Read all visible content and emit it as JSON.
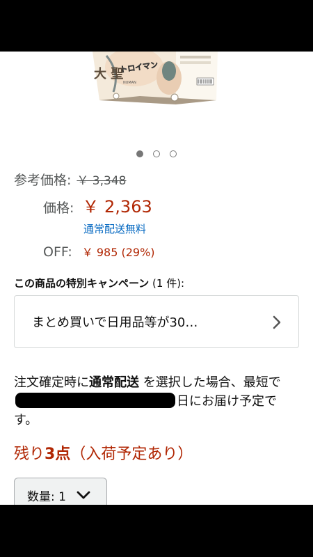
{
  "product": {
    "box_text_main": "トロイマン",
    "box_text_sub": "NUMAN",
    "box_text_side": "大 聖",
    "image_dots": [
      {
        "active": true
      },
      {
        "active": false
      },
      {
        "active": false
      }
    ]
  },
  "pricing": {
    "ref_label": "参考価格:",
    "ref_price": "￥ 3,348",
    "price_label": "価格:",
    "price": "￥ 2,363",
    "shipping": "通常配送無料",
    "off_label": "OFF:",
    "off_value": "￥ 985 (29%)"
  },
  "campaign": {
    "title_bold": "この商品の特別キャンペーン",
    "title_count": " (1 件):",
    "item_text": "まとめ買いで日用品等が30…"
  },
  "delivery": {
    "line_part1": "注文確定時に",
    "line_bold": "通常配送",
    "line_part2": " を選択した場合、最短で",
    "line_part3": "日にお届け予定です。"
  },
  "stock": {
    "prefix": "残り",
    "count_bold": "3点",
    "suffix": "（入荷予定あり）"
  },
  "quantity": {
    "label": "数量: 1"
  },
  "colors": {
    "price_red": "#B12704",
    "link_blue": "#0066C0",
    "muted_gray": "#565959"
  }
}
